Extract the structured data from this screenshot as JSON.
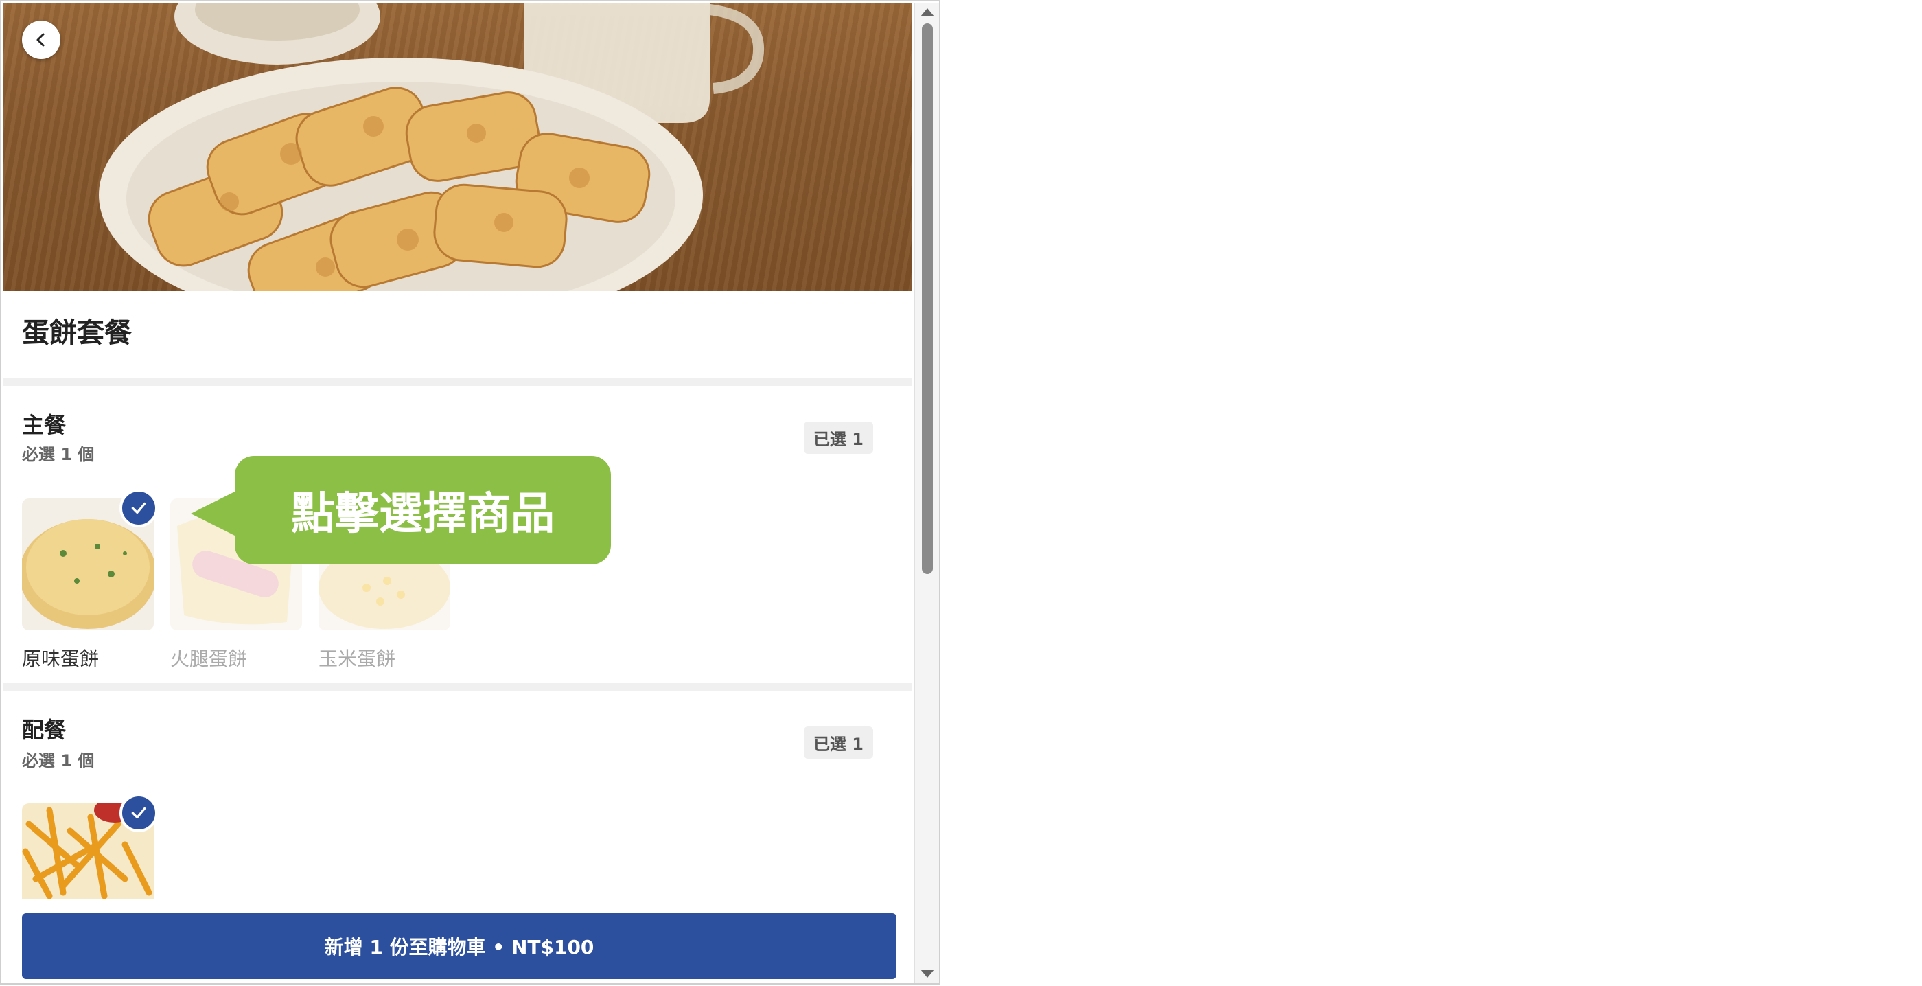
{
  "product": {
    "name": "蛋餅套餐",
    "hero_image": "egg-pancake-rolls-photo"
  },
  "main_course": {
    "title": "主餐",
    "requirement": "必選 1 個",
    "selected_badge": "已選 1",
    "options": [
      {
        "label": "原味蛋餅",
        "selected": true
      },
      {
        "label": "火腿蛋餅",
        "selected": false
      },
      {
        "label": "玉米蛋餅",
        "selected": false
      }
    ]
  },
  "side_dish": {
    "title": "配餐",
    "requirement": "必選 1 個",
    "selected_badge": "已選 1",
    "options": [
      {
        "label": "",
        "selected": true
      }
    ]
  },
  "callout": {
    "text": "點擊選擇商品"
  },
  "cart_button": {
    "label": "新增 1 份至購物車 • NT$100"
  },
  "colors": {
    "primary": "#2c4f9e",
    "callout": "#8bbf45",
    "divider": "#f0f0f0"
  },
  "icons": {
    "back": "chevron-left-icon",
    "check": "checkmark-icon"
  }
}
